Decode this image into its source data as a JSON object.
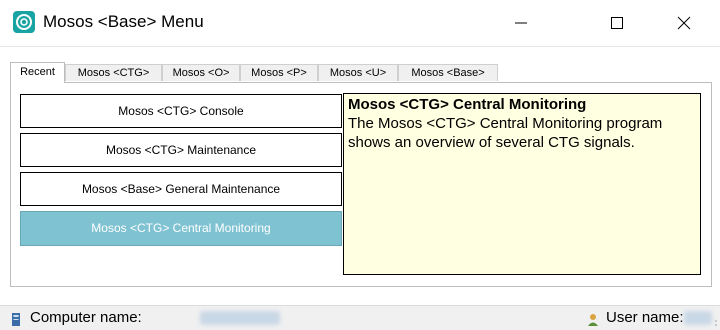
{
  "window": {
    "title": "Mosos <Base> Menu",
    "icon": "mosos-app-icon",
    "controls": [
      "minimize",
      "maximize",
      "close"
    ]
  },
  "tabs": [
    {
      "label": "Recent",
      "active": true
    },
    {
      "label": "Mosos <CTG>",
      "active": false
    },
    {
      "label": "Mosos <O>",
      "active": false
    },
    {
      "label": "Mosos <P>",
      "active": false
    },
    {
      "label": "Mosos <U>",
      "active": false
    },
    {
      "label": "Mosos <Base>",
      "active": false
    }
  ],
  "menu": {
    "items": [
      {
        "label": "Mosos <CTG> Console",
        "selected": false
      },
      {
        "label": "Mosos <CTG> Maintenance",
        "selected": false
      },
      {
        "label": "Mosos <Base> General Maintenance",
        "selected": false
      },
      {
        "label": "Mosos <CTG> Central Monitoring",
        "selected": true
      }
    ]
  },
  "info": {
    "title": "Mosos <CTG> Central Monitoring",
    "description": "The Mosos <CTG> Central Monitoring program shows an overview of several CTG signals."
  },
  "status": {
    "computer_label": "Computer name:",
    "user_label": "User name:",
    "computer_icon": "computer-icon",
    "user_icon": "user-icon"
  },
  "colors": {
    "accent": "#1aa3a3",
    "selected_item": "#7fc2d2",
    "info_background": "#ffffe1"
  }
}
